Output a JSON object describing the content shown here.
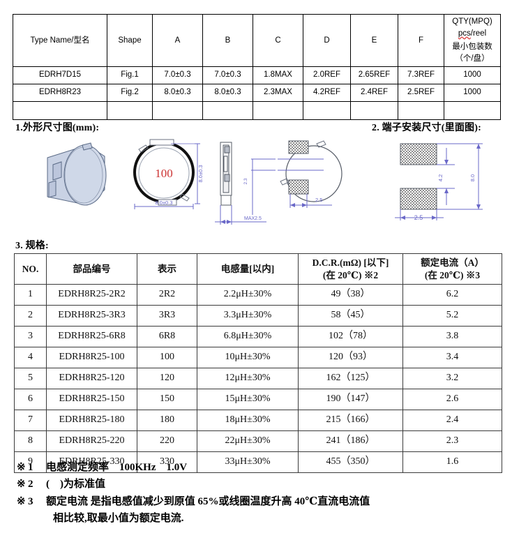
{
  "dimension_table": {
    "headers": [
      "Type Name/型名",
      "Shape",
      "A",
      "B",
      "C",
      "D",
      "E",
      "F"
    ],
    "qty_header_line1": "QTY(MPQ) pcs/reel",
    "qty_header_line2": "最小包装数（个/盘）",
    "rows": [
      {
        "type": "EDRH7D15",
        "shape": "Fig.1",
        "a": "7.0±0.3",
        "b": "7.0±0.3",
        "c": "1.8MAX",
        "d": "2.0REF",
        "e": "2.65REF",
        "f": "7.3REF",
        "qty": "1000"
      },
      {
        "type": "EDRH8R23",
        "shape": "Fig.2",
        "a": "8.0±0.3",
        "b": "8.0±0.3",
        "c": "2.3MAX",
        "d": "4.2REF",
        "e": "2.4REF",
        "f": "2.5REF",
        "qty": "1000"
      },
      {
        "type": "",
        "shape": "",
        "a": "",
        "b": "",
        "c": "",
        "d": "",
        "e": "",
        "f": "",
        "qty": ""
      }
    ]
  },
  "sections": {
    "outline": "1.外形尺寸图(mm):",
    "terminal": "2. 端子安装尺寸(里面图):",
    "spec": "3. 规格:"
  },
  "drawings": {
    "top_view_marking": "100",
    "top_view_dim_width": "8.0±0.3",
    "top_view_dim_height": "8.0±0.3",
    "side_view_dim": "MAX2.5",
    "side_view_dim_small": "2.3",
    "bottom_view_dim": "2.5",
    "terminal_pad_width": "2.5",
    "terminal_gap": "4.2",
    "terminal_height": "8.0",
    "colors": {
      "dimension_line": "#6a68c8",
      "marking_text": "#cc3333",
      "body_fill": "#ccd4e6",
      "pad_hatch": "#808080"
    }
  },
  "spec_table": {
    "headers": {
      "no": "NO.",
      "part_number": "部品编号",
      "marking": "表示",
      "inductance": "电感量[以内]",
      "dcr_line1": "D.C.R.(mΩ) [以下]",
      "dcr_line2": "(在 20℃)  ※2",
      "current_line1": "额定电流（A）",
      "current_line2": "(在 20℃) ※3"
    },
    "rows": [
      {
        "no": "1",
        "part": "EDRH8R25-2R2",
        "marking": "2R2",
        "inductance": "2.2μH±30%",
        "dcr": "49（38）",
        "current": "6.2"
      },
      {
        "no": "2",
        "part": "EDRH8R25-3R3",
        "marking": "3R3",
        "inductance": "3.3μH±30%",
        "dcr": "58（45）",
        "current": "5.2"
      },
      {
        "no": "3",
        "part": "EDRH8R25-6R8",
        "marking": "6R8",
        "inductance": "6.8μH±30%",
        "dcr": "102（78）",
        "current": "3.8"
      },
      {
        "no": "4",
        "part": "EDRH8R25-100",
        "marking": "100",
        "inductance": "10μH±30%",
        "dcr": "120（93）",
        "current": "3.4"
      },
      {
        "no": "5",
        "part": "EDRH8R25-120",
        "marking": "120",
        "inductance": "12μH±30%",
        "dcr": "162（125）",
        "current": "3.2"
      },
      {
        "no": "6",
        "part": "EDRH8R25-150",
        "marking": "150",
        "inductance": "15μH±30%",
        "dcr": "190（147）",
        "current": "2.6"
      },
      {
        "no": "7",
        "part": "EDRH8R25-180",
        "marking": "180",
        "inductance": "18μH±30%",
        "dcr": "215（166）",
        "current": "2.4"
      },
      {
        "no": "8",
        "part": "EDRH8R25-220",
        "marking": "220",
        "inductance": "22μH±30%",
        "dcr": "241（186）",
        "current": "2.3"
      },
      {
        "no": "9",
        "part": "EDRH8R25-330",
        "marking": "330",
        "inductance": "33μH±30%",
        "dcr": "455（350）",
        "current": "1.6"
      }
    ]
  },
  "notes": {
    "n1_mark": "※",
    "n1_num": "1",
    "n1_text": "电感测定频率　100KHz　1.0V",
    "n2_mark": "※",
    "n2_num": "2",
    "n2_text": "(　)为标准值",
    "n3_mark": "※",
    "n3_num": "3",
    "n3_text": "额定电流 是指电感值减少到原值 65%或线圈温度升高 40℃直流电流值",
    "n3_cont": "相比较,取最小值为额定电流."
  }
}
